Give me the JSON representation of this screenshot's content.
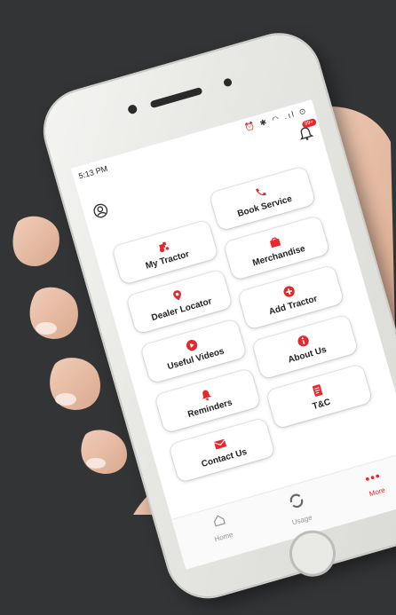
{
  "status": {
    "time": "5:13 PM",
    "icons": "⏰ ✱ ◠ .ıl ⊙",
    "notification_count": "99+"
  },
  "menu": [
    {
      "label": "My Tractor",
      "icon": "tractor-icon"
    },
    {
      "label": "Book Service",
      "icon": "phone-icon"
    },
    {
      "label": "Dealer Locator",
      "icon": "location-pin-icon"
    },
    {
      "label": "Merchandise",
      "icon": "shopping-bag-icon"
    },
    {
      "label": "Useful Videos",
      "icon": "play-icon"
    },
    {
      "label": "Add Tractor",
      "icon": "plus-circle-icon"
    },
    {
      "label": "Reminders",
      "icon": "bell-icon"
    },
    {
      "label": "About Us",
      "icon": "info-icon"
    },
    {
      "label": "Contact Us",
      "icon": "mail-icon"
    },
    {
      "label": "T&C",
      "icon": "document-icon"
    }
  ],
  "nav": {
    "home": "Home",
    "usage": "Usage",
    "more": "More"
  },
  "colors": {
    "accent": "#e8262b",
    "background": "#333436"
  }
}
